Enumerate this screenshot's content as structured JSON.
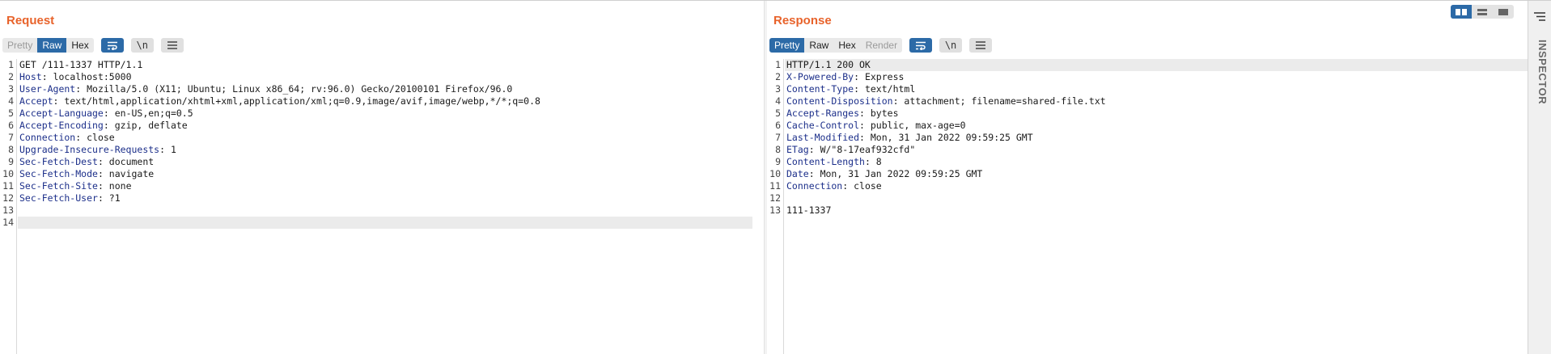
{
  "request": {
    "title": "Request",
    "tabs": [
      {
        "label": "Pretty",
        "state": "disabled"
      },
      {
        "label": "Raw",
        "state": "active"
      },
      {
        "label": "Hex",
        "state": "normal"
      }
    ],
    "newline_label": "\\n",
    "lines": [
      {
        "n": "1",
        "name": "",
        "value": "GET /111-1337 HTTP/1.1"
      },
      {
        "n": "2",
        "name": "Host",
        "value": "localhost:5000"
      },
      {
        "n": "3",
        "name": "User-Agent",
        "value": "Mozilla/5.0 (X11; Ubuntu; Linux x86_64; rv:96.0) Gecko/20100101 Firefox/96.0"
      },
      {
        "n": "4",
        "name": "Accept",
        "value": "text/html,application/xhtml+xml,application/xml;q=0.9,image/avif,image/webp,*/*;q=0.8"
      },
      {
        "n": "5",
        "name": "Accept-Language",
        "value": "en-US,en;q=0.5"
      },
      {
        "n": "6",
        "name": "Accept-Encoding",
        "value": "gzip, deflate"
      },
      {
        "n": "7",
        "name": "Connection",
        "value": "close"
      },
      {
        "n": "8",
        "name": "Upgrade-Insecure-Requests",
        "value": "1"
      },
      {
        "n": "9",
        "name": "Sec-Fetch-Dest",
        "value": "document"
      },
      {
        "n": "10",
        "name": "Sec-Fetch-Mode",
        "value": "navigate"
      },
      {
        "n": "11",
        "name": "Sec-Fetch-Site",
        "value": "none"
      },
      {
        "n": "12",
        "name": "Sec-Fetch-User",
        "value": "?1"
      },
      {
        "n": "13",
        "name": "",
        "value": ""
      },
      {
        "n": "14",
        "name": "",
        "value": ""
      }
    ],
    "highlighted_line": "14"
  },
  "response": {
    "title": "Response",
    "tabs": [
      {
        "label": "Pretty",
        "state": "active"
      },
      {
        "label": "Raw",
        "state": "normal"
      },
      {
        "label": "Hex",
        "state": "normal"
      },
      {
        "label": "Render",
        "state": "disabled"
      }
    ],
    "newline_label": "\\n",
    "lines": [
      {
        "n": "1",
        "name": "",
        "value": "HTTP/1.1 200 OK"
      },
      {
        "n": "2",
        "name": "X-Powered-By",
        "value": "Express"
      },
      {
        "n": "3",
        "name": "Content-Type",
        "value": "text/html"
      },
      {
        "n": "4",
        "name": "Content-Disposition",
        "value": "attachment; filename=shared-file.txt"
      },
      {
        "n": "5",
        "name": "Accept-Ranges",
        "value": "bytes"
      },
      {
        "n": "6",
        "name": "Cache-Control",
        "value": "public, max-age=0"
      },
      {
        "n": "7",
        "name": "Last-Modified",
        "value": "Mon, 31 Jan 2022 09:59:25 GMT"
      },
      {
        "n": "8",
        "name": "ETag",
        "value": "W/\"8-17eaf932cfd\""
      },
      {
        "n": "9",
        "name": "Content-Length",
        "value": "8"
      },
      {
        "n": "10",
        "name": "Date",
        "value": "Mon, 31 Jan 2022 09:59:25 GMT"
      },
      {
        "n": "11",
        "name": "Connection",
        "value": "close"
      },
      {
        "n": "12",
        "name": "",
        "value": ""
      },
      {
        "n": "13",
        "name": "",
        "value": "111-1337"
      }
    ],
    "highlighted_line": "1"
  },
  "view_modes": [
    {
      "icon": "split-columns-icon",
      "state": "active"
    },
    {
      "icon": "split-rows-icon",
      "state": "normal"
    },
    {
      "icon": "single-pane-icon",
      "state": "normal"
    }
  ],
  "inspector": {
    "label": "INSPECTOR",
    "menu_icon": "panel-menu-icon"
  },
  "colors": {
    "title": "#e8632b",
    "accent": "#2c6aa7",
    "header_name": "#1c2f8a"
  }
}
